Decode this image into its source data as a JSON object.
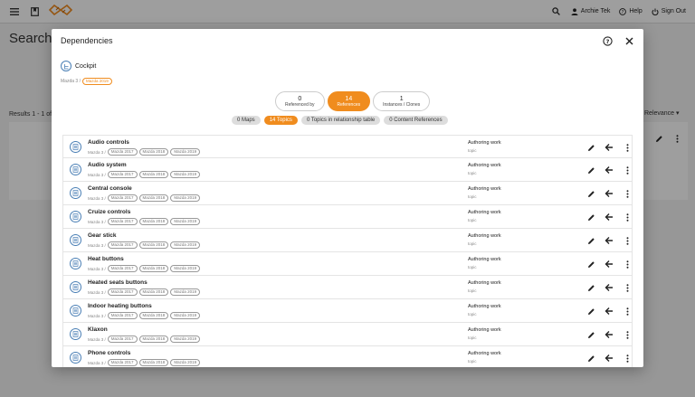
{
  "topbar": {
    "user_name": "Archie Tek",
    "help_label": "Help",
    "signout_label": "Sign Out"
  },
  "background": {
    "page_title": "Search",
    "results_text": "Results 1 - 1 of 1",
    "sort_label": "Relevance"
  },
  "modal": {
    "title": "Dependencies",
    "subject": {
      "name": "Cockpit",
      "path": "Mazda 3 /",
      "tag": "Mazda 2019"
    },
    "ref_buttons": [
      {
        "count": "0",
        "label": "Referenced by",
        "active": false
      },
      {
        "count": "14",
        "label": "References",
        "active": true
      },
      {
        "count": "1",
        "label": "Instances / Clones",
        "active": false
      }
    ],
    "chips": [
      {
        "label": "0 Maps",
        "active": false
      },
      {
        "label": "14 Topics",
        "active": true
      },
      {
        "label": "0 Topics in relationship table",
        "active": false
      },
      {
        "label": "0 Content References",
        "active": false
      }
    ],
    "row_path": "Mazda 3 /",
    "row_tags": [
      "Mazda 2017",
      "Mazda 2018",
      "Mazda 2019"
    ],
    "row_status": "Authoring work",
    "row_type": "topic",
    "rows": [
      {
        "title": "Audio controls"
      },
      {
        "title": "Audio system"
      },
      {
        "title": "Central console"
      },
      {
        "title": "Cruize controls"
      },
      {
        "title": "Gear stick"
      },
      {
        "title": "Heat buttons"
      },
      {
        "title": "Heated seats buttons"
      },
      {
        "title": "Indoor heating buttons"
      },
      {
        "title": "Klaxon"
      },
      {
        "title": "Phone controls"
      }
    ]
  },
  "colors": {
    "accent": "#f08c1e",
    "icon_blue": "#4a7fb5"
  }
}
